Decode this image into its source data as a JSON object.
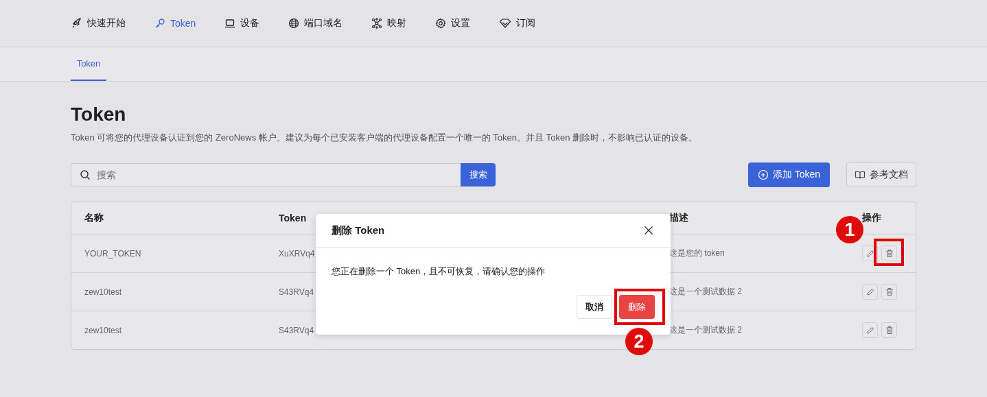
{
  "nav": {
    "items": [
      {
        "label": "快速开始",
        "selected": false
      },
      {
        "label": "Token",
        "selected": true
      },
      {
        "label": "设备",
        "selected": false
      },
      {
        "label": "端口域名",
        "selected": false
      },
      {
        "label": "映射",
        "selected": false
      },
      {
        "label": "设置",
        "selected": false
      },
      {
        "label": "订阅",
        "selected": false
      }
    ]
  },
  "subtabs": [
    {
      "label": "Token",
      "selected": true
    }
  ],
  "page": {
    "title": "Token",
    "description": "Token 可将您的代理设备认证到您的 ZeroNews 帐户。建议为每个已安装客户端的代理设备配置一个唯一的 Token。并且 Token 删除时，不影响已认证的设备。"
  },
  "search": {
    "placeholder": "搜索",
    "button": "搜索"
  },
  "actions": {
    "add": "添加 Token",
    "docs": "参考文档"
  },
  "table": {
    "columns": [
      "名称",
      "Token",
      "描述",
      "操作"
    ],
    "rows": [
      {
        "name": "YOUR_TOKEN",
        "token": "XuXRVq4",
        "description": "这是您的 token"
      },
      {
        "name": "zew10test",
        "token": "S43RVq4",
        "description": "这是一个测试数据 2"
      },
      {
        "name": "zew10test",
        "token": "S43RVq4",
        "description": "这是一个测试数据 2"
      }
    ]
  },
  "dialog": {
    "title": "删除 Token",
    "message": "您正在删除一个 Token，且不可恢复，请确认您的操作",
    "cancel": "取消",
    "confirm": "删除"
  },
  "callouts": [
    {
      "number": "1"
    },
    {
      "number": "2"
    }
  ]
}
